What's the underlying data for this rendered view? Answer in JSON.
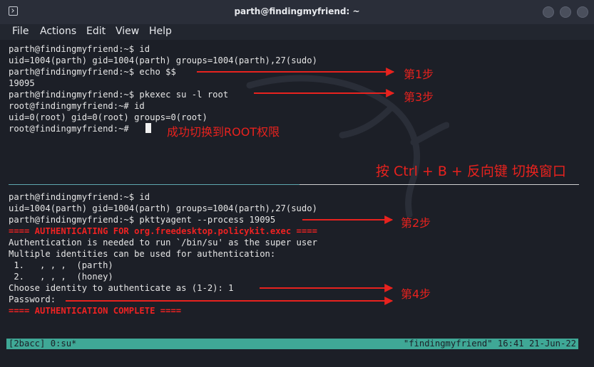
{
  "window": {
    "title": "parth@findingmyfriend: ~"
  },
  "menu": [
    "File",
    "Actions",
    "Edit",
    "View",
    "Help"
  ],
  "top_pane": [
    "parth@findingmyfriend:~$ id",
    "uid=1004(parth) gid=1004(parth) groups=1004(parth),27(sudo)",
    "parth@findingmyfriend:~$ echo $$",
    "19095",
    "parth@findingmyfriend:~$ pkexec su -l root",
    "root@findingmyfriend:~# id",
    "uid=0(root) gid=0(root) groups=0(root)",
    "root@findingmyfriend:~# "
  ],
  "bottom_pane": [
    "parth@findingmyfriend:~$ id",
    "uid=1004(parth) gid=1004(parth) groups=1004(parth),27(sudo)",
    "parth@findingmyfriend:~$ pkttyagent --process 19095",
    "==== AUTHENTICATING FOR org.freedesktop.policykit.exec ====",
    "Authentication is needed to run `/bin/su' as the super user",
    "Multiple identities can be used for authentication:",
    " 1.   , , ,  (parth)",
    " 2.   , , ,  (honey)",
    "Choose identity to authenticate as (1-2): 1",
    "Password:",
    "==== AUTHENTICATION COMPLETE ===="
  ],
  "status_bar": {
    "left": "[2bacc] 0:su*",
    "right": "\"findingmyfriend\" 16:41 21-Jun-22"
  },
  "annotations": {
    "step1": "第1步",
    "step3": "第3步",
    "root_success": "成功切换到ROOT权限",
    "switch_hint": "按 Ctrl + B + 反向键 切换窗口",
    "step2": "第2步",
    "step4": "第4步"
  },
  "colors": {
    "annotation_red": "#e8221e",
    "status_bar": "#3fa896",
    "terminal_bg": "#1c1f27"
  }
}
